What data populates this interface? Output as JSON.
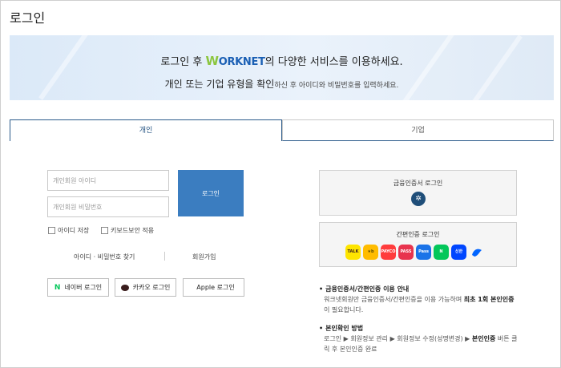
{
  "page": {
    "title": "로그인"
  },
  "banner": {
    "line1_pre": "로그인 후 ",
    "brand_w": "W",
    "brand_rest": "ORKNET",
    "line1_post": "의 다양한 서비스를 이용하세요.",
    "line2_strong": "개인 또는 기업 유형을 확인",
    "line2_small": "하신 후 아이디와 비밀번호를 입력하세요."
  },
  "tabs": [
    {
      "label": "개인",
      "active": true
    },
    {
      "label": "기업",
      "active": false
    }
  ],
  "form": {
    "id_placeholder": "개인회원 아이디",
    "pw_placeholder": "개인회원 비밀번호",
    "login_label": "로그인",
    "save_id_label": "아이디 저장",
    "keyboard_security_label": "키보드보안 적용",
    "find_label": "아이디 · 비밀번호 찾기",
    "signup_label": "회원가입"
  },
  "social": {
    "naver": {
      "icon": "N",
      "label": "네이버 로그인"
    },
    "kakao": {
      "label": "카카오 로그인"
    },
    "apple": {
      "icon": "",
      "label": "Apple 로그인"
    }
  },
  "cert": {
    "financial_title": "금융인증서 로그인",
    "simple_title": "간편인증 로그인",
    "apps": [
      {
        "name": "kakao",
        "text": "TALK",
        "bg": "#fee500",
        "fg": "#3a1d1d"
      },
      {
        "name": "kb",
        "text": "★b",
        "bg": "#ffbc00",
        "fg": "#5a4a00"
      },
      {
        "name": "payco",
        "text": "PAYCO",
        "bg": "#ff3c3c",
        "fg": "#fff"
      },
      {
        "name": "pass",
        "text": "PASS",
        "bg": "#e8344e",
        "fg": "#fff"
      },
      {
        "name": "samsung-pass",
        "text": "Pass",
        "bg": "#1a73e8",
        "fg": "#fff"
      },
      {
        "name": "naver",
        "text": "N",
        "bg": "#03c75a",
        "fg": "#fff"
      },
      {
        "name": "shinhan",
        "text": "신한",
        "bg": "#0046ff",
        "fg": "#fff"
      },
      {
        "name": "toss",
        "text": "",
        "bg": "#f5f5f5",
        "fg": "#0064ff"
      }
    ]
  },
  "info": {
    "guide_title": "금융인증서/간편인증 이용 안내",
    "guide_body_pre": "워크넷회원만 금융인증서/간편인증을 이용 가능하며 ",
    "guide_body_bold": "최초 1회 본인인증",
    "guide_body_post": "이 필요합니다.",
    "method_title": "본인확인 방법",
    "method_body_pre": "로그인 ▶ 회원정보 관리 ▶ 회원정보 수정(성명변경) ▶ ",
    "method_body_bold": "본인인증",
    "method_body_post": " 버튼 클릭 후 본인인증 완료"
  }
}
